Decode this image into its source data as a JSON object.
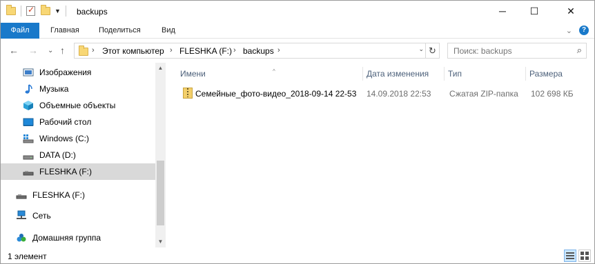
{
  "window": {
    "title": "backups",
    "controls": {
      "minimize": "─",
      "maximize": "☐",
      "close": "✕"
    }
  },
  "ribbon": {
    "tabs": [
      {
        "label": "Файл"
      },
      {
        "label": "Главная"
      },
      {
        "label": "Поделиться"
      },
      {
        "label": "Вид"
      }
    ],
    "collapse_glyph": "⌄",
    "help_glyph": "?"
  },
  "address": {
    "back_glyph": "←",
    "forward_glyph": "→",
    "recent_glyph": "⌄",
    "up_glyph": "↑",
    "segments": [
      "Этот компьютер",
      "FLESHKA (F:)",
      "backups"
    ],
    "separator": "›",
    "dropdown_glyph": "⌄",
    "refresh_glyph": "↻"
  },
  "search": {
    "placeholder": "Поиск: backups",
    "icon": "search-icon"
  },
  "nav": {
    "items": [
      {
        "label": "Изображения",
        "icon": "pictures-icon"
      },
      {
        "label": "Музыка",
        "icon": "music-icon"
      },
      {
        "label": "Объемные объекты",
        "icon": "3d-objects-icon"
      },
      {
        "label": "Рабочий стол",
        "icon": "desktop-icon"
      },
      {
        "label": "Windows (C:)",
        "icon": "drive-icon"
      },
      {
        "label": "DATA (D:)",
        "icon": "drive-icon"
      },
      {
        "label": "FLESHKA (F:)",
        "icon": "usb-drive-icon",
        "selected": true
      },
      {
        "label": "FLESHKA (F:)",
        "icon": "usb-drive-icon"
      },
      {
        "label": "Сеть",
        "icon": "network-icon"
      },
      {
        "label": "Домашняя группа",
        "icon": "homegroup-icon"
      }
    ]
  },
  "columns": {
    "name": "Имени",
    "date": "Дата изменения",
    "type": "Тип",
    "size": "Размера"
  },
  "files": [
    {
      "name": "Семейные_фото-видео_2018-09-14 22-53",
      "date": "14.09.2018 22:53",
      "type": "Сжатая ZIP-папка",
      "size": "102 698 КБ",
      "icon": "zip-folder-icon"
    }
  ],
  "status": {
    "count_text": "1 элемент"
  },
  "colors": {
    "accent": "#1979ca",
    "selection": "#d9d9d9",
    "header_text": "#4c607a",
    "folder": "#f8d775"
  }
}
